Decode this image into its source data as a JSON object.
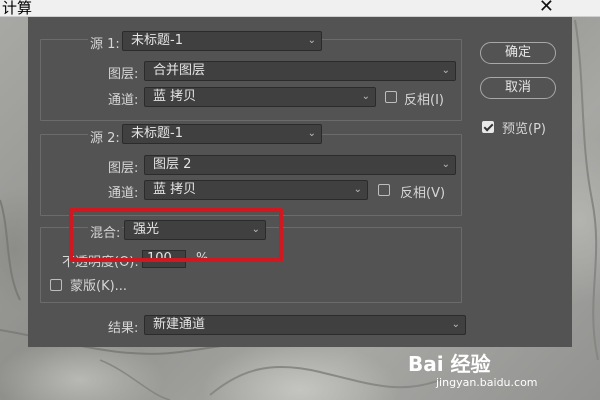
{
  "window": {
    "title": "计算",
    "close": "✕"
  },
  "source1": {
    "label": "源 1:",
    "value": "未标题-1",
    "layer_label": "图层:",
    "layer_value": "合并图层",
    "channel_label": "通道:",
    "channel_value": "蓝 拷贝",
    "invert_label": "反相(I)",
    "invert_checked": false
  },
  "source2": {
    "label": "源 2:",
    "value": "未标题-1",
    "layer_label": "图层:",
    "layer_value": "图层 2",
    "channel_label": "通道:",
    "channel_value": "蓝 拷贝",
    "invert_label": "反相(V)",
    "invert_checked": false
  },
  "blend": {
    "label": "混合:",
    "value": "强光",
    "opacity_label": "不透明度(O):",
    "opacity_value": "100",
    "opacity_unit": "%",
    "mask_label": "蒙版(K)..."
  },
  "result": {
    "label": "结果:",
    "value": "新建通道"
  },
  "buttons": {
    "ok": "确定",
    "cancel": "取消"
  },
  "preview": {
    "label": "预览(P)",
    "checked": true
  },
  "watermark": {
    "brand": "Bai 经验",
    "url": "jingyan.baidu.com"
  },
  "colors": {
    "dialog_bg": "#535353",
    "highlight": "#d01820",
    "field_bg": "#404040"
  }
}
